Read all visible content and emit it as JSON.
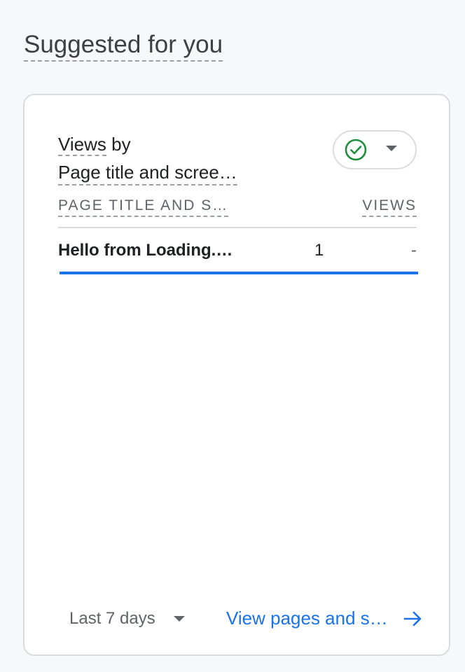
{
  "section": {
    "title": "Suggested for you"
  },
  "card": {
    "title_prefix": "Views",
    "title_by": " by",
    "title_dimension": "Page title and scree…",
    "status_icon": "check-circle-icon",
    "table": {
      "columns": [
        "PAGE TITLE AND S…",
        "VIEWS"
      ],
      "rows": [
        {
          "label": "Hello from Loading.…",
          "value": "1",
          "change": "-",
          "bar_fraction": 1.0
        }
      ]
    },
    "footer": {
      "date_range": "Last 7 days",
      "link_label": "View pages and s…"
    }
  },
  "colors": {
    "accent": "#1a73e8",
    "check_green": "#1e8e3e",
    "muted": "#5f6368"
  }
}
